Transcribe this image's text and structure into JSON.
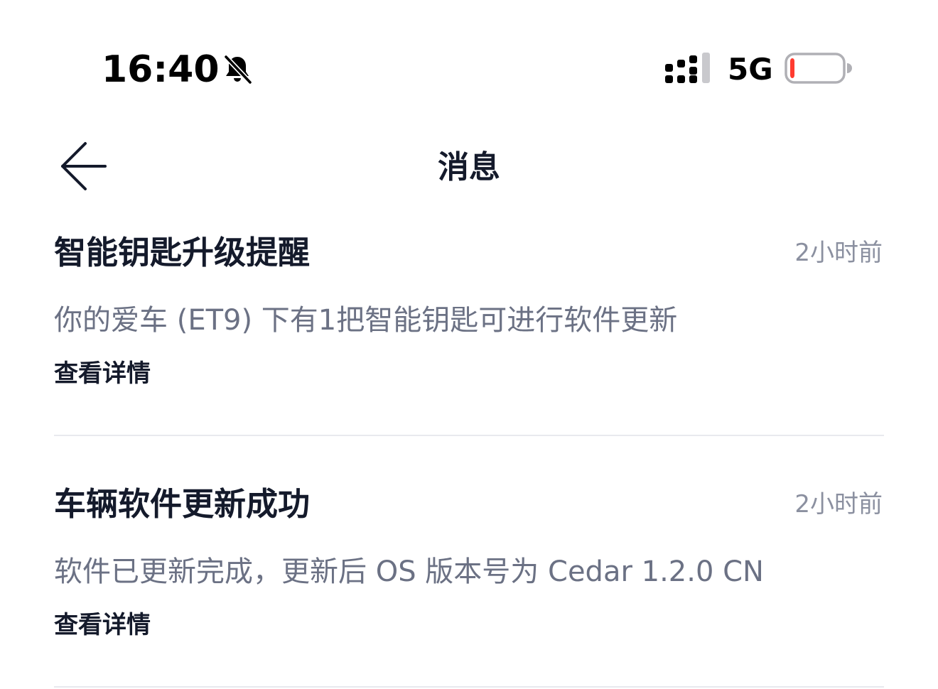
{
  "status_bar": {
    "time": "16:40",
    "network": "5G",
    "icons": {
      "silent": "bell-slash-icon",
      "signal": "signal-icon",
      "battery": "battery-low-icon"
    },
    "battery_fill_fraction": 0.08,
    "battery_color": "#ff3b30"
  },
  "nav": {
    "title": "消息",
    "back_icon": "arrow-left-icon"
  },
  "messages": [
    {
      "title": "智能钥匙升级提醒",
      "time": "2小时前",
      "body": "你的爱车 (ET9) 下有1把智能钥匙可进行软件更新",
      "link": "查看详情"
    },
    {
      "title": "车辆软件更新成功",
      "time": "2小时前",
      "body": "软件已更新完成，更新后 OS 版本号为 Cedar 1.2.0 CN",
      "link": "查看详情"
    }
  ],
  "colors": {
    "primary_text": "#141a2b",
    "secondary_text": "#6b7184",
    "time_text": "#8b90a0",
    "divider": "#e8e9ee"
  }
}
